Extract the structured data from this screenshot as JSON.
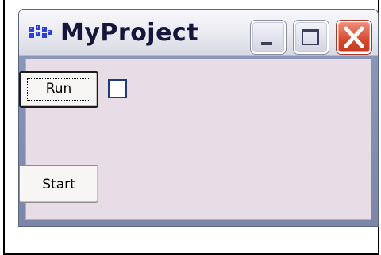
{
  "window": {
    "title": "MyProject",
    "icon": "app-grid-icon",
    "controls": {
      "minimize_icon": "minimize-icon",
      "maximize_icon": "maximize-icon",
      "close_icon": "close-icon"
    }
  },
  "client": {
    "run_button_label": "Run",
    "run_checkbox_checked": false,
    "start_button_label": "Start"
  },
  "colors": {
    "title_text": "#14163a",
    "client_bg": "#e8dde6",
    "close_button": "#d4492c"
  }
}
